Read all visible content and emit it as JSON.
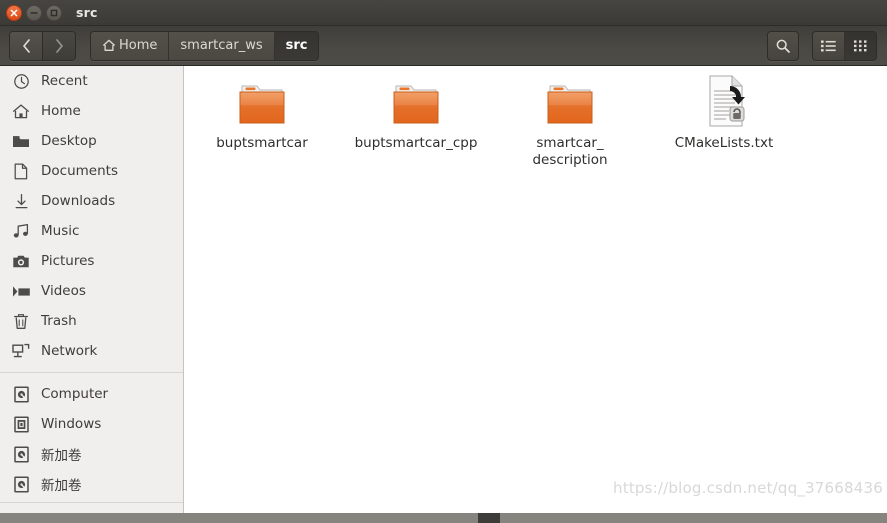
{
  "window": {
    "title": "src",
    "controls": [
      {
        "name": "close",
        "glyph": "×"
      },
      {
        "name": "minimize",
        "glyph": "−"
      },
      {
        "name": "maximize",
        "glyph": "□"
      }
    ]
  },
  "toolbar": {
    "back_label": "‹",
    "forward_label": "›",
    "breadcrumbs": [
      {
        "label": "Home",
        "icon": "home-icon",
        "active": false
      },
      {
        "label": "smartcar_ws",
        "icon": "",
        "active": false
      },
      {
        "label": "src",
        "icon": "",
        "active": true
      }
    ],
    "search_icon": "search-icon",
    "views": [
      {
        "name": "list-view",
        "icon": "list-view-icon",
        "active": false
      },
      {
        "name": "grid-view",
        "icon": "grid-view-icon",
        "active": true
      }
    ]
  },
  "sidebar": {
    "items": [
      {
        "label": "Recent",
        "icon": "clock-icon"
      },
      {
        "label": "Home",
        "icon": "home-icon"
      },
      {
        "label": "Desktop",
        "icon": "folder-icon"
      },
      {
        "label": "Documents",
        "icon": "document-icon"
      },
      {
        "label": "Downloads",
        "icon": "download-icon"
      },
      {
        "label": "Music",
        "icon": "music-note-icon"
      },
      {
        "label": "Pictures",
        "icon": "camera-icon"
      },
      {
        "label": "Videos",
        "icon": "video-icon"
      },
      {
        "label": "Trash",
        "icon": "trash-icon"
      },
      {
        "label": "Network",
        "icon": "network-icon"
      }
    ],
    "devices": [
      {
        "label": "Computer",
        "icon": "drive-icon"
      },
      {
        "label": "Windows",
        "icon": "volume-icon"
      },
      {
        "label": "新加卷",
        "icon": "drive-icon"
      },
      {
        "label": "新加卷",
        "icon": "drive-icon"
      }
    ]
  },
  "content": {
    "items": [
      {
        "label": "buptsmartcar",
        "type": "folder"
      },
      {
        "label": "buptsmartcar_cpp",
        "type": "folder"
      },
      {
        "label": "smartcar_\ndescription",
        "type": "folder"
      },
      {
        "label": "CMakeLists.txt",
        "type": "text-file-locked"
      }
    ],
    "watermark": "https://blog.csdn.net/qq_37668436"
  },
  "colors": {
    "titlebar": "#3c3a36",
    "toolbar": "#4b4944",
    "close_button": "#da4a16",
    "folder": "#e8762c",
    "sidebar_bg": "#f1efee",
    "content_bg": "#ffffff"
  }
}
